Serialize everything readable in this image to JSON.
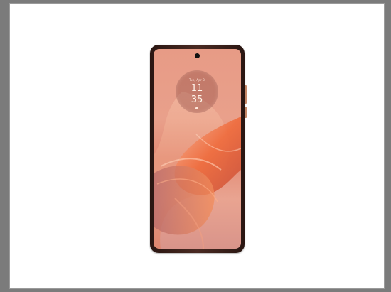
{
  "lock_screen": {
    "date": "Tue, Apr 3",
    "hour": "11",
    "minute": "35"
  },
  "colors": {
    "background_frame": "#7b7b7b",
    "panel": "#ffffff",
    "phone_body": "#3a2019",
    "screen_peach": "#e9a08b",
    "swirl_orange": "#ee6a3a"
  }
}
